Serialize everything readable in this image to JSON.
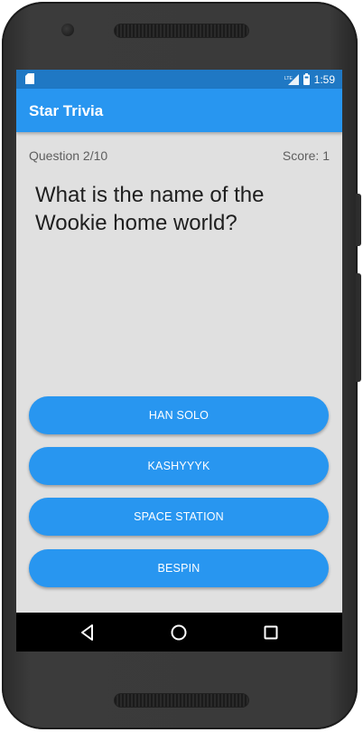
{
  "status_bar": {
    "time": "1:59",
    "icons": [
      "sd-card-icon",
      "lte-signal-icon",
      "battery-icon"
    ],
    "network_label": "LTE"
  },
  "app_bar": {
    "title": "Star Trivia",
    "color": "#2896f0"
  },
  "quiz": {
    "question_counter": "Question 2/10",
    "score": "Score: 1",
    "question": "What is the name of the Wookie home world?",
    "answers": [
      "HAN SOLO",
      "KASHYYYK",
      "SPACE STATION",
      "BESPIN"
    ]
  },
  "nav_bar": {
    "icons": [
      "back-icon",
      "home-icon",
      "recents-icon"
    ]
  },
  "colors": {
    "primary": "#2896f0",
    "status_bar": "#1f78c4",
    "background": "#e0e0e0"
  }
}
